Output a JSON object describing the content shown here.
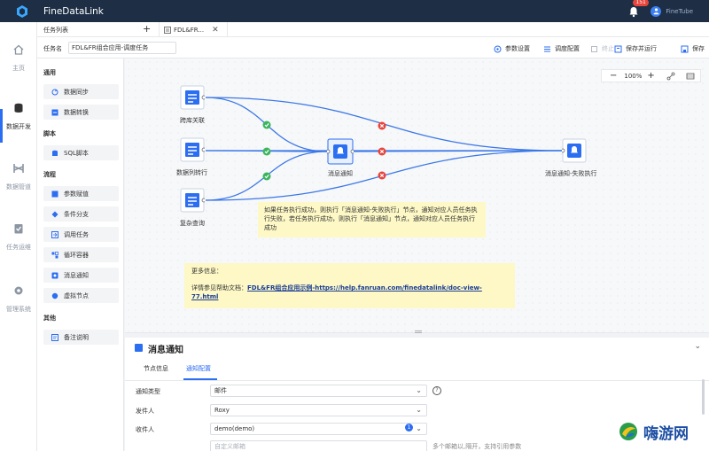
{
  "app": {
    "title": "FineDataLink",
    "notification_count": "151",
    "user_name": "FineTube"
  },
  "leftnav": {
    "items": [
      {
        "label": "主页",
        "icon": "home-icon"
      },
      {
        "label": "数据开发",
        "icon": "database-icon",
        "active": true
      },
      {
        "label": "数据管道",
        "icon": "pipeline-icon"
      },
      {
        "label": "任务运维",
        "icon": "ops-icon"
      },
      {
        "label": "管理系统",
        "icon": "gear-icon"
      }
    ]
  },
  "tabs": {
    "task_list": "任务列表",
    "open_tab": "FDL&FR..."
  },
  "namebar": {
    "label": "任务名",
    "value": "FDL&FR组合应用-调度任务",
    "actions": {
      "params": "参数设置",
      "schedule": "调度配置",
      "stop": "终止",
      "save_run": "保存并运行",
      "save": "保存"
    }
  },
  "palette": {
    "groups": [
      {
        "title": "通用",
        "items": [
          "数据同步",
          "数据转换"
        ]
      },
      {
        "title": "脚本",
        "items": [
          "SQL脚本"
        ]
      },
      {
        "title": "流程",
        "items": [
          "参数赋值",
          "条件分支",
          "调用任务",
          "循环容器",
          "消息通知",
          "虚拟节点"
        ]
      },
      {
        "title": "其他",
        "items": [
          "备注说明"
        ]
      }
    ]
  },
  "canvas": {
    "zoom": "100%",
    "nodes": {
      "n1": "跨库关联",
      "n2": "数据列转行",
      "n3": "复杂查询",
      "notify": "消息通知",
      "fail": "消息通知-失败执行"
    },
    "note1": "如果任务执行成功，则执行「消息通知-失败执行」节点，通知对应人员任务执行失败，若任务执行成功，则执行「消息通知」节点，通知对应人员任务执行成功",
    "note2_title": "更多信息：",
    "note2_prefix": "详情参见帮助文档：",
    "note2_link": "FDL&FR组合应用示例-https://help.fanruan.com/finedatalink/doc-view-77.html",
    "colors": {
      "edge": "#3b78e7",
      "success": "#3cb55e",
      "fail": "#e8453c"
    }
  },
  "panel": {
    "title": "消息通知",
    "tabs": [
      "节点信息",
      "通知配置"
    ],
    "active_tab": 1,
    "fields": {
      "type": {
        "label": "通知类型",
        "value": "邮件"
      },
      "sender": {
        "label": "发件人",
        "value": "Roxy"
      },
      "recipient": {
        "label": "收件人",
        "value": "demo(demo)",
        "count": "1"
      },
      "custom_placeholder": "自定义邮箱",
      "custom_hint": "多个邮箱以,隔开，支持引用参数"
    }
  },
  "watermark": {
    "text": "嗨游网"
  }
}
